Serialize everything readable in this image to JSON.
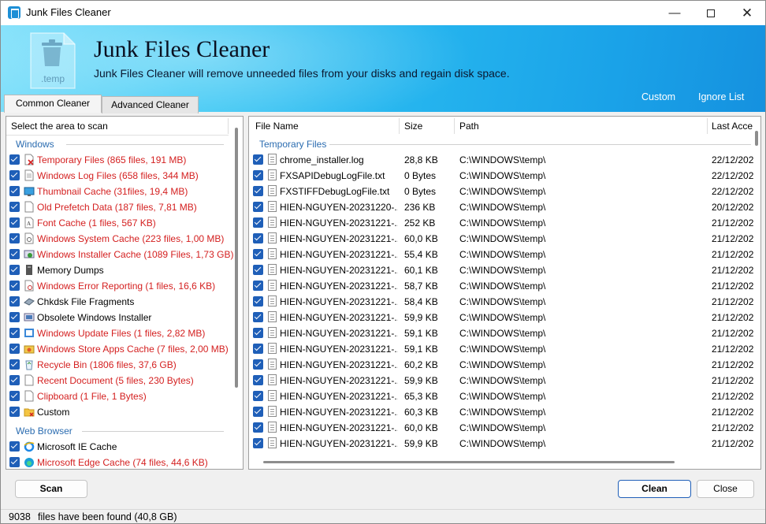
{
  "window": {
    "title": "Junk Files Cleaner"
  },
  "banner": {
    "title": "Junk Files Cleaner",
    "subtitle": "Junk Files Cleaner will remove unneeded files from your disks and regain disk space.",
    "icon_text": ".temp",
    "links": {
      "custom": "Custom",
      "ignore_list": "Ignore List"
    }
  },
  "tabs": {
    "common": "Common Cleaner",
    "advanced": "Advanced Cleaner"
  },
  "left_panel": {
    "header": "Select the area to scan",
    "groups": [
      {
        "label": "Windows",
        "items": [
          {
            "label": "Temporary Files (865 files, 191 MB)",
            "red": true,
            "icon": "temp-files-icon"
          },
          {
            "label": "Windows Log Files (658 files, 344 MB)",
            "red": true,
            "icon": "log-file-icon"
          },
          {
            "label": "Thumbnail Cache (31files, 19,4 MB)",
            "red": true,
            "icon": "thumbnail-icon"
          },
          {
            "label": "Old Prefetch Data (187 files, 7,81 MB)",
            "red": true,
            "icon": "prefetch-icon"
          },
          {
            "label": "Font Cache (1 files, 567 KB)",
            "red": true,
            "icon": "font-icon"
          },
          {
            "label": "Windows System Cache (223 files, 1,00 MB)",
            "red": true,
            "icon": "system-cache-icon"
          },
          {
            "label": "Windows Installer Cache (1089 Files, 1,73 GB)",
            "red": true,
            "icon": "installer-icon"
          },
          {
            "label": "Memory Dumps",
            "red": false,
            "icon": "memory-icon"
          },
          {
            "label": "Windows Error Reporting (1 files, 16,6 KB)",
            "red": true,
            "icon": "error-report-icon"
          },
          {
            "label": "Chkdsk File Fragments",
            "red": false,
            "icon": "chkdsk-icon"
          },
          {
            "label": "Obsolete Windows Installer",
            "red": false,
            "icon": "obsolete-installer-icon"
          },
          {
            "label": "Windows Update Files (1 files, 2,82 MB)",
            "red": true,
            "icon": "update-icon"
          },
          {
            "label": "Windows Store Apps Cache (7 files, 2,00 MB)",
            "red": true,
            "icon": "store-icon"
          },
          {
            "label": "Recycle Bin (1806 files, 37,6 GB)",
            "red": true,
            "icon": "recycle-bin-icon"
          },
          {
            "label": "Recent Document (5 files, 230 Bytes)",
            "red": true,
            "icon": "recent-doc-icon"
          },
          {
            "label": "Clipboard (1 File, 1 Bytes)",
            "red": true,
            "icon": "clipboard-icon"
          },
          {
            "label": "Custom",
            "red": false,
            "icon": "custom-folder-icon"
          }
        ]
      },
      {
        "label": "Web Browser",
        "items": [
          {
            "label": "Microsoft IE Cache",
            "red": false,
            "icon": "ie-icon"
          },
          {
            "label": "Microsoft Edge Cache (74 files, 44,6 KB)",
            "red": true,
            "icon": "edge-icon"
          }
        ]
      }
    ]
  },
  "file_list": {
    "columns": [
      "File Name",
      "Size",
      "Path",
      "Last Acce"
    ],
    "group_label": "Temporary Files",
    "rows": [
      [
        "chrome_installer.log",
        "28,8 KB",
        "C:\\WINDOWS\\temp\\",
        "22/12/202"
      ],
      [
        "FXSAPIDebugLogFile.txt",
        "0 Bytes",
        "C:\\WINDOWS\\temp\\",
        "22/12/202"
      ],
      [
        "FXSTIFFDebugLogFile.txt",
        "0 Bytes",
        "C:\\WINDOWS\\temp\\",
        "22/12/202"
      ],
      [
        "HIEN-NGUYEN-20231220-...",
        "236 KB",
        "C:\\WINDOWS\\temp\\",
        "20/12/202"
      ],
      [
        "HIEN-NGUYEN-20231221-...",
        "252 KB",
        "C:\\WINDOWS\\temp\\",
        "21/12/202"
      ],
      [
        "HIEN-NGUYEN-20231221-...",
        "60,0 KB",
        "C:\\WINDOWS\\temp\\",
        "21/12/202"
      ],
      [
        "HIEN-NGUYEN-20231221-...",
        "55,4 KB",
        "C:\\WINDOWS\\temp\\",
        "21/12/202"
      ],
      [
        "HIEN-NGUYEN-20231221-...",
        "60,1 KB",
        "C:\\WINDOWS\\temp\\",
        "21/12/202"
      ],
      [
        "HIEN-NGUYEN-20231221-...",
        "58,7 KB",
        "C:\\WINDOWS\\temp\\",
        "21/12/202"
      ],
      [
        "HIEN-NGUYEN-20231221-...",
        "58,4 KB",
        "C:\\WINDOWS\\temp\\",
        "21/12/202"
      ],
      [
        "HIEN-NGUYEN-20231221-...",
        "59,9 KB",
        "C:\\WINDOWS\\temp\\",
        "21/12/202"
      ],
      [
        "HIEN-NGUYEN-20231221-...",
        "59,1 KB",
        "C:\\WINDOWS\\temp\\",
        "21/12/202"
      ],
      [
        "HIEN-NGUYEN-20231221-...",
        "59,1 KB",
        "C:\\WINDOWS\\temp\\",
        "21/12/202"
      ],
      [
        "HIEN-NGUYEN-20231221-...",
        "60,2 KB",
        "C:\\WINDOWS\\temp\\",
        "21/12/202"
      ],
      [
        "HIEN-NGUYEN-20231221-...",
        "59,9 KB",
        "C:\\WINDOWS\\temp\\",
        "21/12/202"
      ],
      [
        "HIEN-NGUYEN-20231221-...",
        "65,3 KB",
        "C:\\WINDOWS\\temp\\",
        "21/12/202"
      ],
      [
        "HIEN-NGUYEN-20231221-...",
        "60,3 KB",
        "C:\\WINDOWS\\temp\\",
        "21/12/202"
      ],
      [
        "HIEN-NGUYEN-20231221-...",
        "60,0 KB",
        "C:\\WINDOWS\\temp\\",
        "21/12/202"
      ],
      [
        "HIEN-NGUYEN-20231221-...",
        "59,9 KB",
        "C:\\WINDOWS\\temp\\",
        "21/12/202"
      ]
    ]
  },
  "buttons": {
    "scan": "Scan",
    "clean": "Clean",
    "close": "Close"
  },
  "status": {
    "count": "9038",
    "text": "files have been found (40,8 GB)"
  },
  "colors": {
    "accent": "#1f5fb8",
    "warning_text": "#d42020",
    "group_label": "#2b6cb0"
  }
}
